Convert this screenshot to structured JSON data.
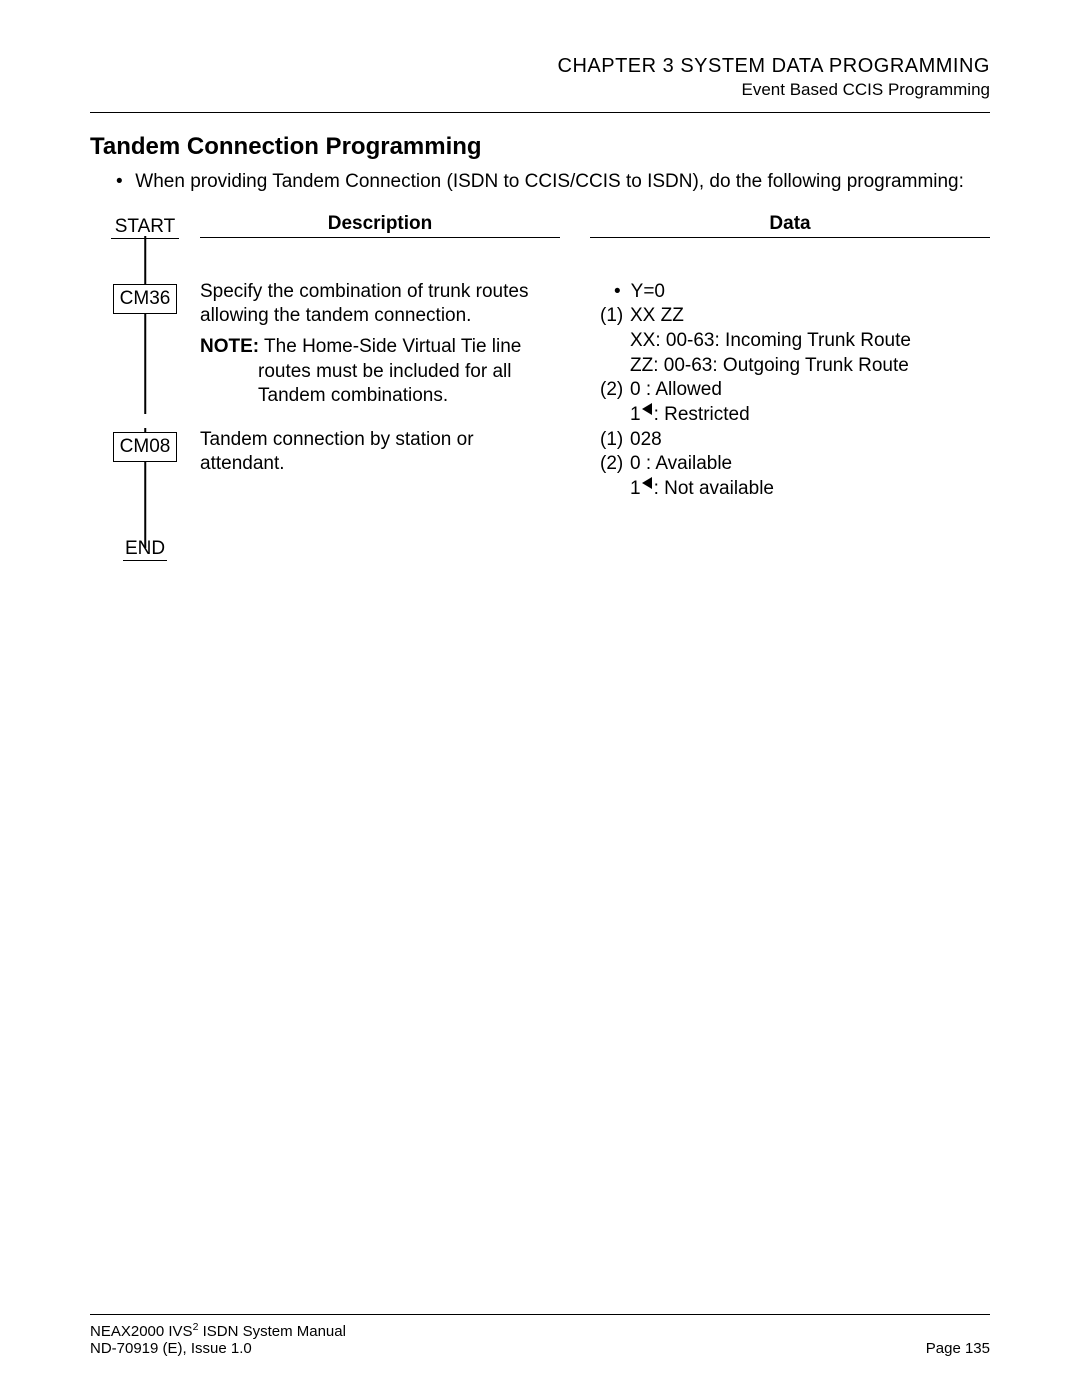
{
  "header": {
    "chapter": "CHAPTER 3  SYSTEM DATA PROGRAMMING",
    "sub": "Event Based CCIS Programming"
  },
  "title": "Tandem Connection Programming",
  "intro": "When providing Tandem Connection (ISDN to CCIS/CCIS to ISDN), do the following programming:",
  "columns": {
    "start": "START",
    "desc": "Description",
    "data": "Data",
    "end": "END"
  },
  "steps": [
    {
      "cmd": "CM36",
      "desc_main": "Specify the combination of trunk routes allowing the tandem connection.",
      "note_label": "NOTE:",
      "note_text": "The Home-Side Virtual Tie line routes must be included for all Tandem combinations.",
      "data_bullet": "Y=0",
      "data_lines": [
        {
          "n": "(1)",
          "t": "XX ZZ"
        },
        {
          "n": "",
          "t": "XX: 00-63: Incoming Trunk Route"
        },
        {
          "n": "",
          "t": "ZZ: 00-63: Outgoing Trunk Route"
        },
        {
          "n": "(2)",
          "t": "0   : Allowed"
        },
        {
          "n": "",
          "t": "1◀: Restricted",
          "tri": true,
          "pre": "1",
          "post": ": Restricted"
        }
      ]
    },
    {
      "cmd": "CM08",
      "desc_main": "Tandem connection by station or attendant.",
      "data_lines": [
        {
          "n": "(1)",
          "t": "028"
        },
        {
          "n": "(2)",
          "t": "0   : Available"
        },
        {
          "n": "",
          "t": "1◀: Not available",
          "tri": true,
          "pre": "1",
          "post": ": Not available"
        }
      ]
    }
  ],
  "footer": {
    "manual_pre": "NEAX2000 IVS",
    "manual_sup": "2",
    "manual_post": " ISDN System Manual",
    "doc": "ND-70919 (E), Issue 1.0",
    "page": "Page 135"
  }
}
